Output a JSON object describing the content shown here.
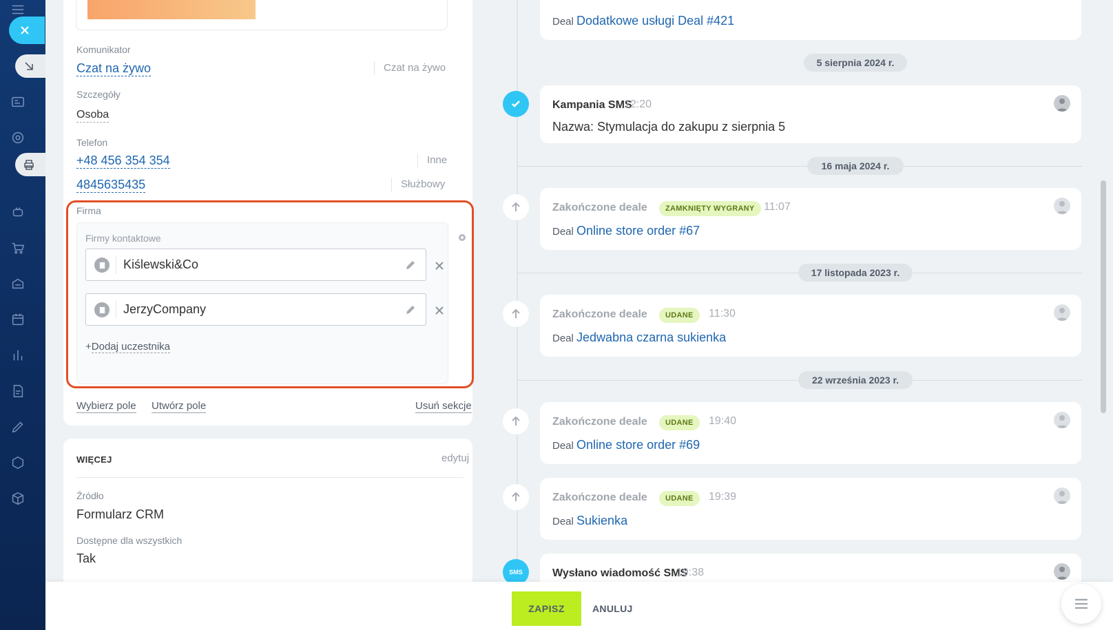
{
  "left": {
    "messenger": {
      "label": "Komunikator",
      "value": "Czat na żywo",
      "tag": "Czat na żywo"
    },
    "details": {
      "label": "Szczegóły",
      "value": "Osoba"
    },
    "phone": {
      "label": "Telefon",
      "numbers": [
        {
          "value": "+48 456 354 354",
          "tag": "Inne"
        },
        {
          "value": "4845635435",
          "tag": "Służbowy"
        }
      ]
    },
    "company": {
      "label": "Firma",
      "sublabel": "Firmy kontaktowe",
      "items": [
        "Kiślewski&Co",
        "JerzyCompany"
      ],
      "add_label": "Dodaj uczestnika",
      "add_plus": "+"
    },
    "footer": {
      "select_field": "Wybierz pole",
      "create_field": "Utwórz pole",
      "delete_section": "Usuń sekcje"
    },
    "more": {
      "title": "WIĘCEJ",
      "edit": "edytuj",
      "source_label": "Źródło",
      "source_value": "Formularz CRM",
      "available_label": "Dostępne dla wszystkich",
      "available_value": "Tak"
    }
  },
  "timeline": {
    "top_event": {
      "prefix": "Deal",
      "link": "Dodatkowe usługi Deal #421"
    },
    "dates": [
      "5 sierpnia 2024 r.",
      "16 maja 2024 r.",
      "17 listopada 2023 r.",
      "22 września 2023 r."
    ],
    "sms_campaign": {
      "title": "Kampania SMS",
      "time": "12:20",
      "body": "Nazwa: Stymulacja do zakupu z sierpnia 5"
    },
    "deals": [
      {
        "title": "Zakończone deale",
        "badge": "ZAMKNIĘTY WYGRANY",
        "time": "11:07",
        "prefix": "Deal",
        "link": "Online store order #67"
      },
      {
        "title": "Zakończone deale",
        "badge": "UDANE",
        "time": "11:30",
        "prefix": "Deal",
        "link": "Jedwabna czarna sukienka"
      },
      {
        "title": "Zakończone deale",
        "badge": "UDANE",
        "time": "19:40",
        "prefix": "Deal",
        "link": "Online store order #69"
      },
      {
        "title": "Zakończone deale",
        "badge": "UDANE",
        "time": "19:39",
        "prefix": "Deal",
        "link": "Sukienka"
      }
    ],
    "sms_sent": {
      "title": "Wysłano wiadomość SMS",
      "time": "19:38"
    }
  },
  "actions": {
    "save": "ZAPISZ",
    "cancel": "ANULUJ"
  },
  "colors": {
    "accent": "#2fc6f6",
    "save": "#bbed21",
    "highlight": "#e14f26",
    "link": "#2067b0"
  }
}
